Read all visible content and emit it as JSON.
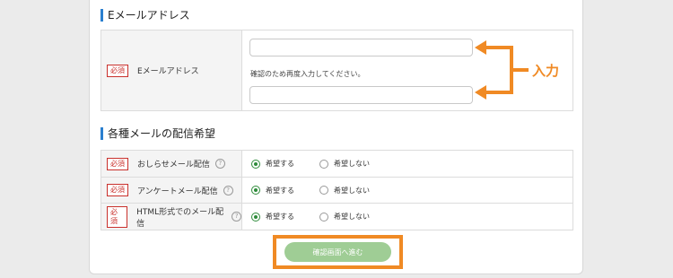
{
  "email_section": {
    "title": "Eメールアドレス",
    "required_badge": "必須",
    "field_label": "Eメールアドレス",
    "email_value": "",
    "confirm_note": "確認のため再度入力してください。",
    "confirm_value": ""
  },
  "prefs_section": {
    "title": "各種メールの配信希望",
    "rows": [
      {
        "required_badge": "必須",
        "label": "おしらせメール配信",
        "help": "?",
        "option_yes": "希望する",
        "option_no": "希望しない",
        "selected": "希望する"
      },
      {
        "required_badge": "必須",
        "label": "アンケートメール配信",
        "help": "?",
        "option_yes": "希望する",
        "option_no": "希望しない",
        "selected": "希望する"
      },
      {
        "required_badge": "必須",
        "label": "HTML形式でのメール配信",
        "help": "?",
        "option_yes": "希望する",
        "option_no": "希望しない",
        "selected": "希望する"
      }
    ]
  },
  "submit_label": "確認画面へ進む",
  "annotation": "入力",
  "colors": {
    "accent": "#f08a24",
    "radio_on": "#2e8b3a",
    "button": "#9fcd95",
    "required": "#c9302c",
    "heading_bar": "#2a7fcf"
  }
}
